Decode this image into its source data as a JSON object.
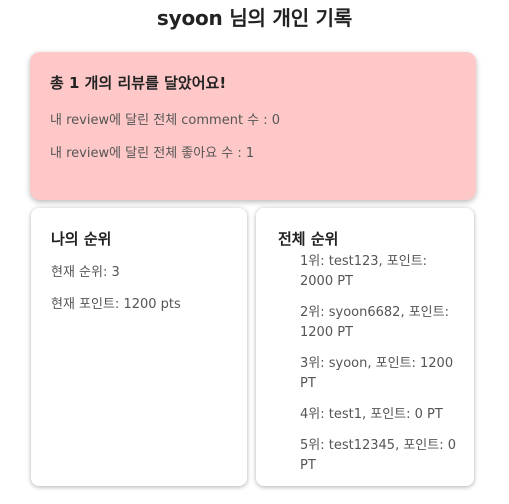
{
  "page": {
    "title": "syoon 님의 개인 기록"
  },
  "summary": {
    "heading": "총 1 개의 리뷰를 달았어요!",
    "comment_line": "내 review에 달린 전체 comment 수 : 0",
    "like_line": "내 review에 달린 전체 좋아요 수 : 1"
  },
  "my_rank": {
    "heading": "나의 순위",
    "current_rank": "현재 순위: 3",
    "current_points": "현재 포인트: 1200 pts"
  },
  "overall_rank": {
    "heading": "전체 순위",
    "entries": [
      "1위: test123, 포인트: 2000 PT",
      "2위: syoon6682, 포인트: 1200 PT",
      "3위: syoon, 포인트: 1200 PT",
      "4위: test1, 포인트: 0 PT",
      "5위: test12345, 포인트: 0 PT"
    ]
  },
  "colors": {
    "summary_background": "#ffc8c8",
    "card_background": "#ffffff"
  }
}
